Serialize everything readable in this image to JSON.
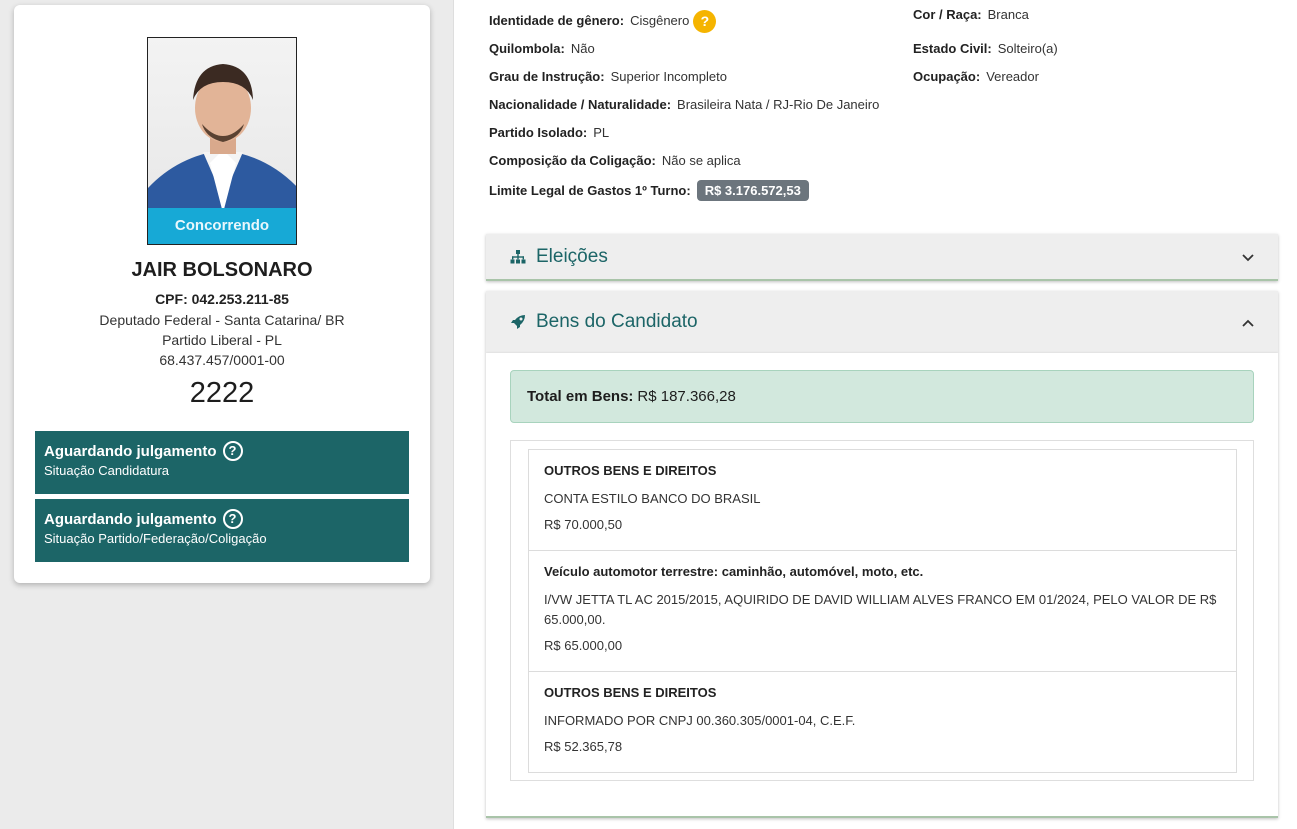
{
  "candidate": {
    "photo_status": "Concorrendo",
    "name": "JAIR BOLSONARO",
    "cpf": "CPF: 042.253.211-85",
    "office": "Deputado Federal - Santa Catarina/ BR",
    "party": "Partido Liberal - PL",
    "cnpj": "68.437.457/0001-00",
    "number": "2222",
    "status": [
      {
        "title": "Aguardando julgamento",
        "subtitle": "Situação Candidatura"
      },
      {
        "title": "Aguardando julgamento",
        "subtitle": "Situação Partido/Federação/Coligação"
      }
    ],
    "help_glyph": "?"
  },
  "info": {
    "gender_label": "Identidade de gênero:",
    "gender_value": "Cisgênero",
    "gender_help": "?",
    "race_label": "Cor / Raça:",
    "race_value": "Branca",
    "quilombola_label": "Quilombola:",
    "quilombola_value": "Não",
    "civil_label": "Estado Civil:",
    "civil_value": "Solteiro(a)",
    "education_label": "Grau de Instrução:",
    "education_value": "Superior Incompleto",
    "occupation_label": "Ocupação:",
    "occupation_value": "Vereador",
    "nationality_label": "Nacionalidade / Naturalidade:",
    "nationality_value": "Brasileira Nata / RJ-Rio De Janeiro",
    "party_label": "Partido Isolado:",
    "party_value": "PL",
    "coalition_label": "Composição da Coligação:",
    "coalition_value": "Não se aplica",
    "limit_label": "Limite Legal de Gastos 1º Turno:",
    "limit_value": "R$ 3.176.572,53"
  },
  "sections": {
    "elections_title": "Eleições",
    "assets_title": "Bens do Candidato"
  },
  "assets": {
    "total_label": "Total em Bens:",
    "total_value": "R$ 187.366,28",
    "items": [
      {
        "type": "OUTROS BENS E DIREITOS",
        "description": "CONTA ESTILO BANCO DO BRASIL",
        "value": "R$ 70.000,50"
      },
      {
        "type": "Veículo automotor terrestre: caminhão, automóvel, moto, etc.",
        "description": "I/VW JETTA TL AC 2015/2015, AQUIRIDO DE DAVID WILLIAM ALVES FRANCO EM 01/2024, PELO VALOR DE R$ 65.000,00.",
        "value": "R$ 65.000,00"
      },
      {
        "type": "OUTROS BENS E DIREITOS",
        "description": "INFORMADO POR CNPJ 00.360.305/0001-04, C.E.F.",
        "value": "R$ 52.365,78"
      }
    ]
  },
  "colors": {
    "teal": "#1c6567",
    "status_blue": "#17a9d6",
    "help_yellow": "#f5b400",
    "total_green": "#d2e8dd"
  }
}
